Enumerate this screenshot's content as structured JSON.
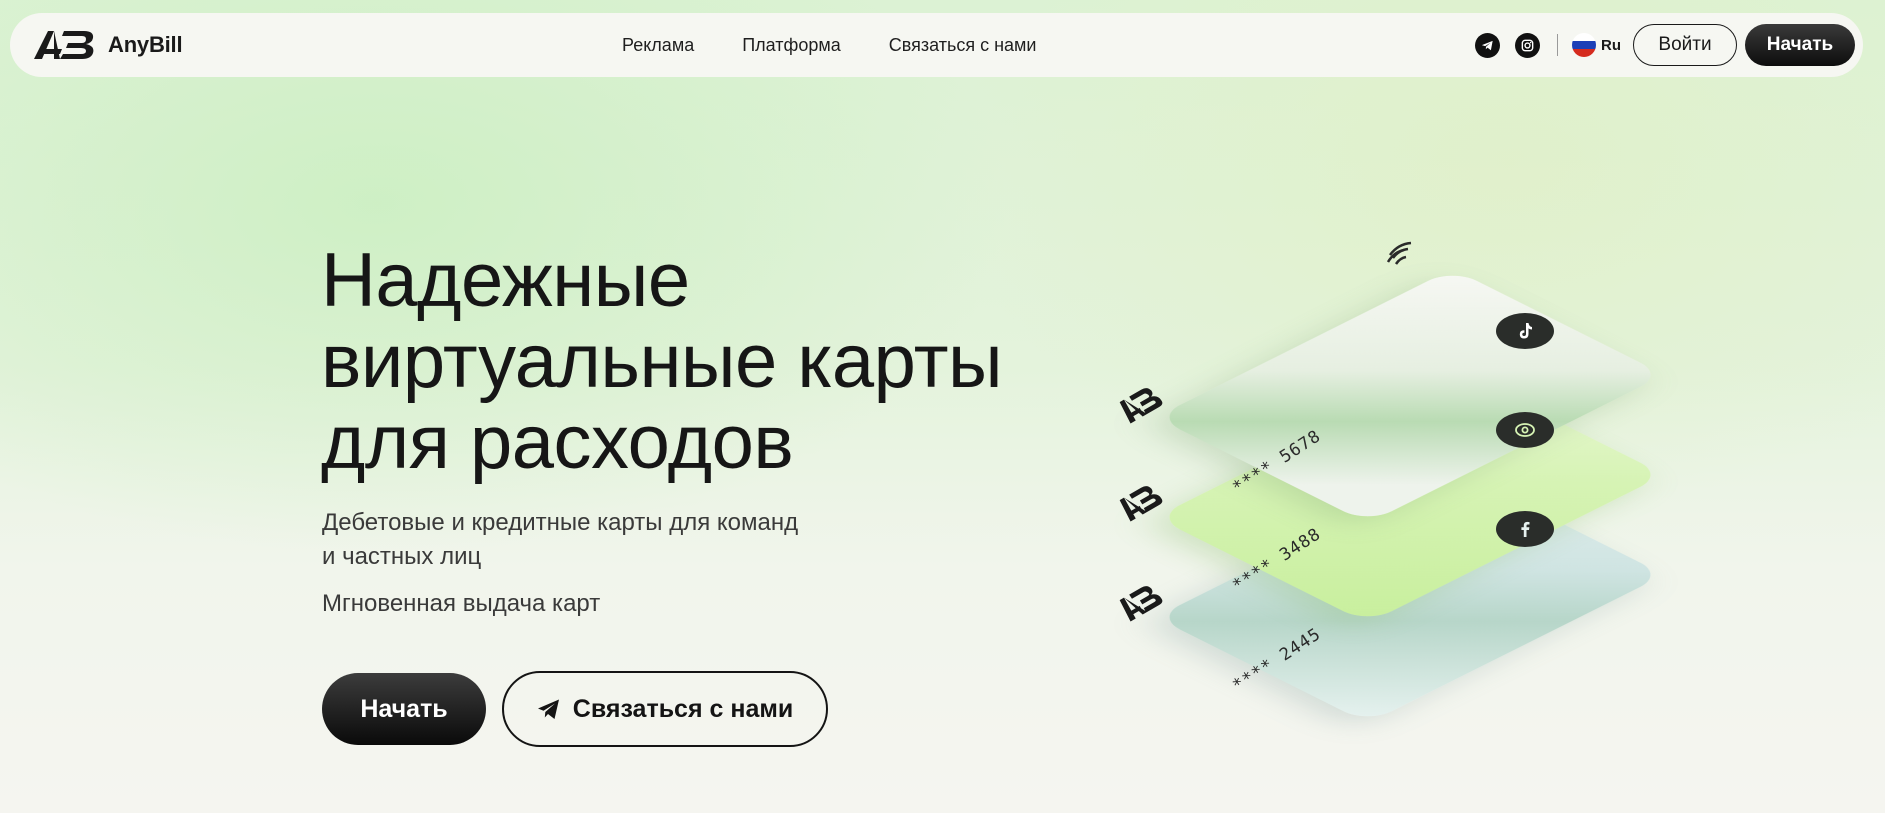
{
  "brand": {
    "name": "AnyBill"
  },
  "nav": {
    "links": [
      "Реклама",
      "Платформа",
      "Связаться с нами"
    ],
    "language": "Ru",
    "login_label": "Войти",
    "start_label": "Начать"
  },
  "hero": {
    "title_lines": [
      "Надежные",
      "виртуальные карты",
      "для расходов"
    ],
    "subtitle_lines": [
      "Дебетовые и кредитные карты для команд",
      "и частных лиц"
    ],
    "note": "Мгновенная выдача карт",
    "start_label": "Начать",
    "contact_label": "Связаться с нами"
  },
  "cards": [
    {
      "number": "**** 5678",
      "badge_icon": "tiktok-icon"
    },
    {
      "number": "**** 3488",
      "badge_icon": "eye-icon"
    },
    {
      "number": "**** 2445",
      "badge_icon": "facebook-icon"
    }
  ],
  "icons": {
    "social": [
      "telegram-icon",
      "instagram-icon"
    ],
    "contact_button": "telegram-plane-icon",
    "card_top": "contactless-icon"
  },
  "colors": {
    "primary_button": "#111111",
    "background_top": "#dcf2d4",
    "background_bottom": "#f5f5f0",
    "card_green": "#c8ef9d"
  }
}
